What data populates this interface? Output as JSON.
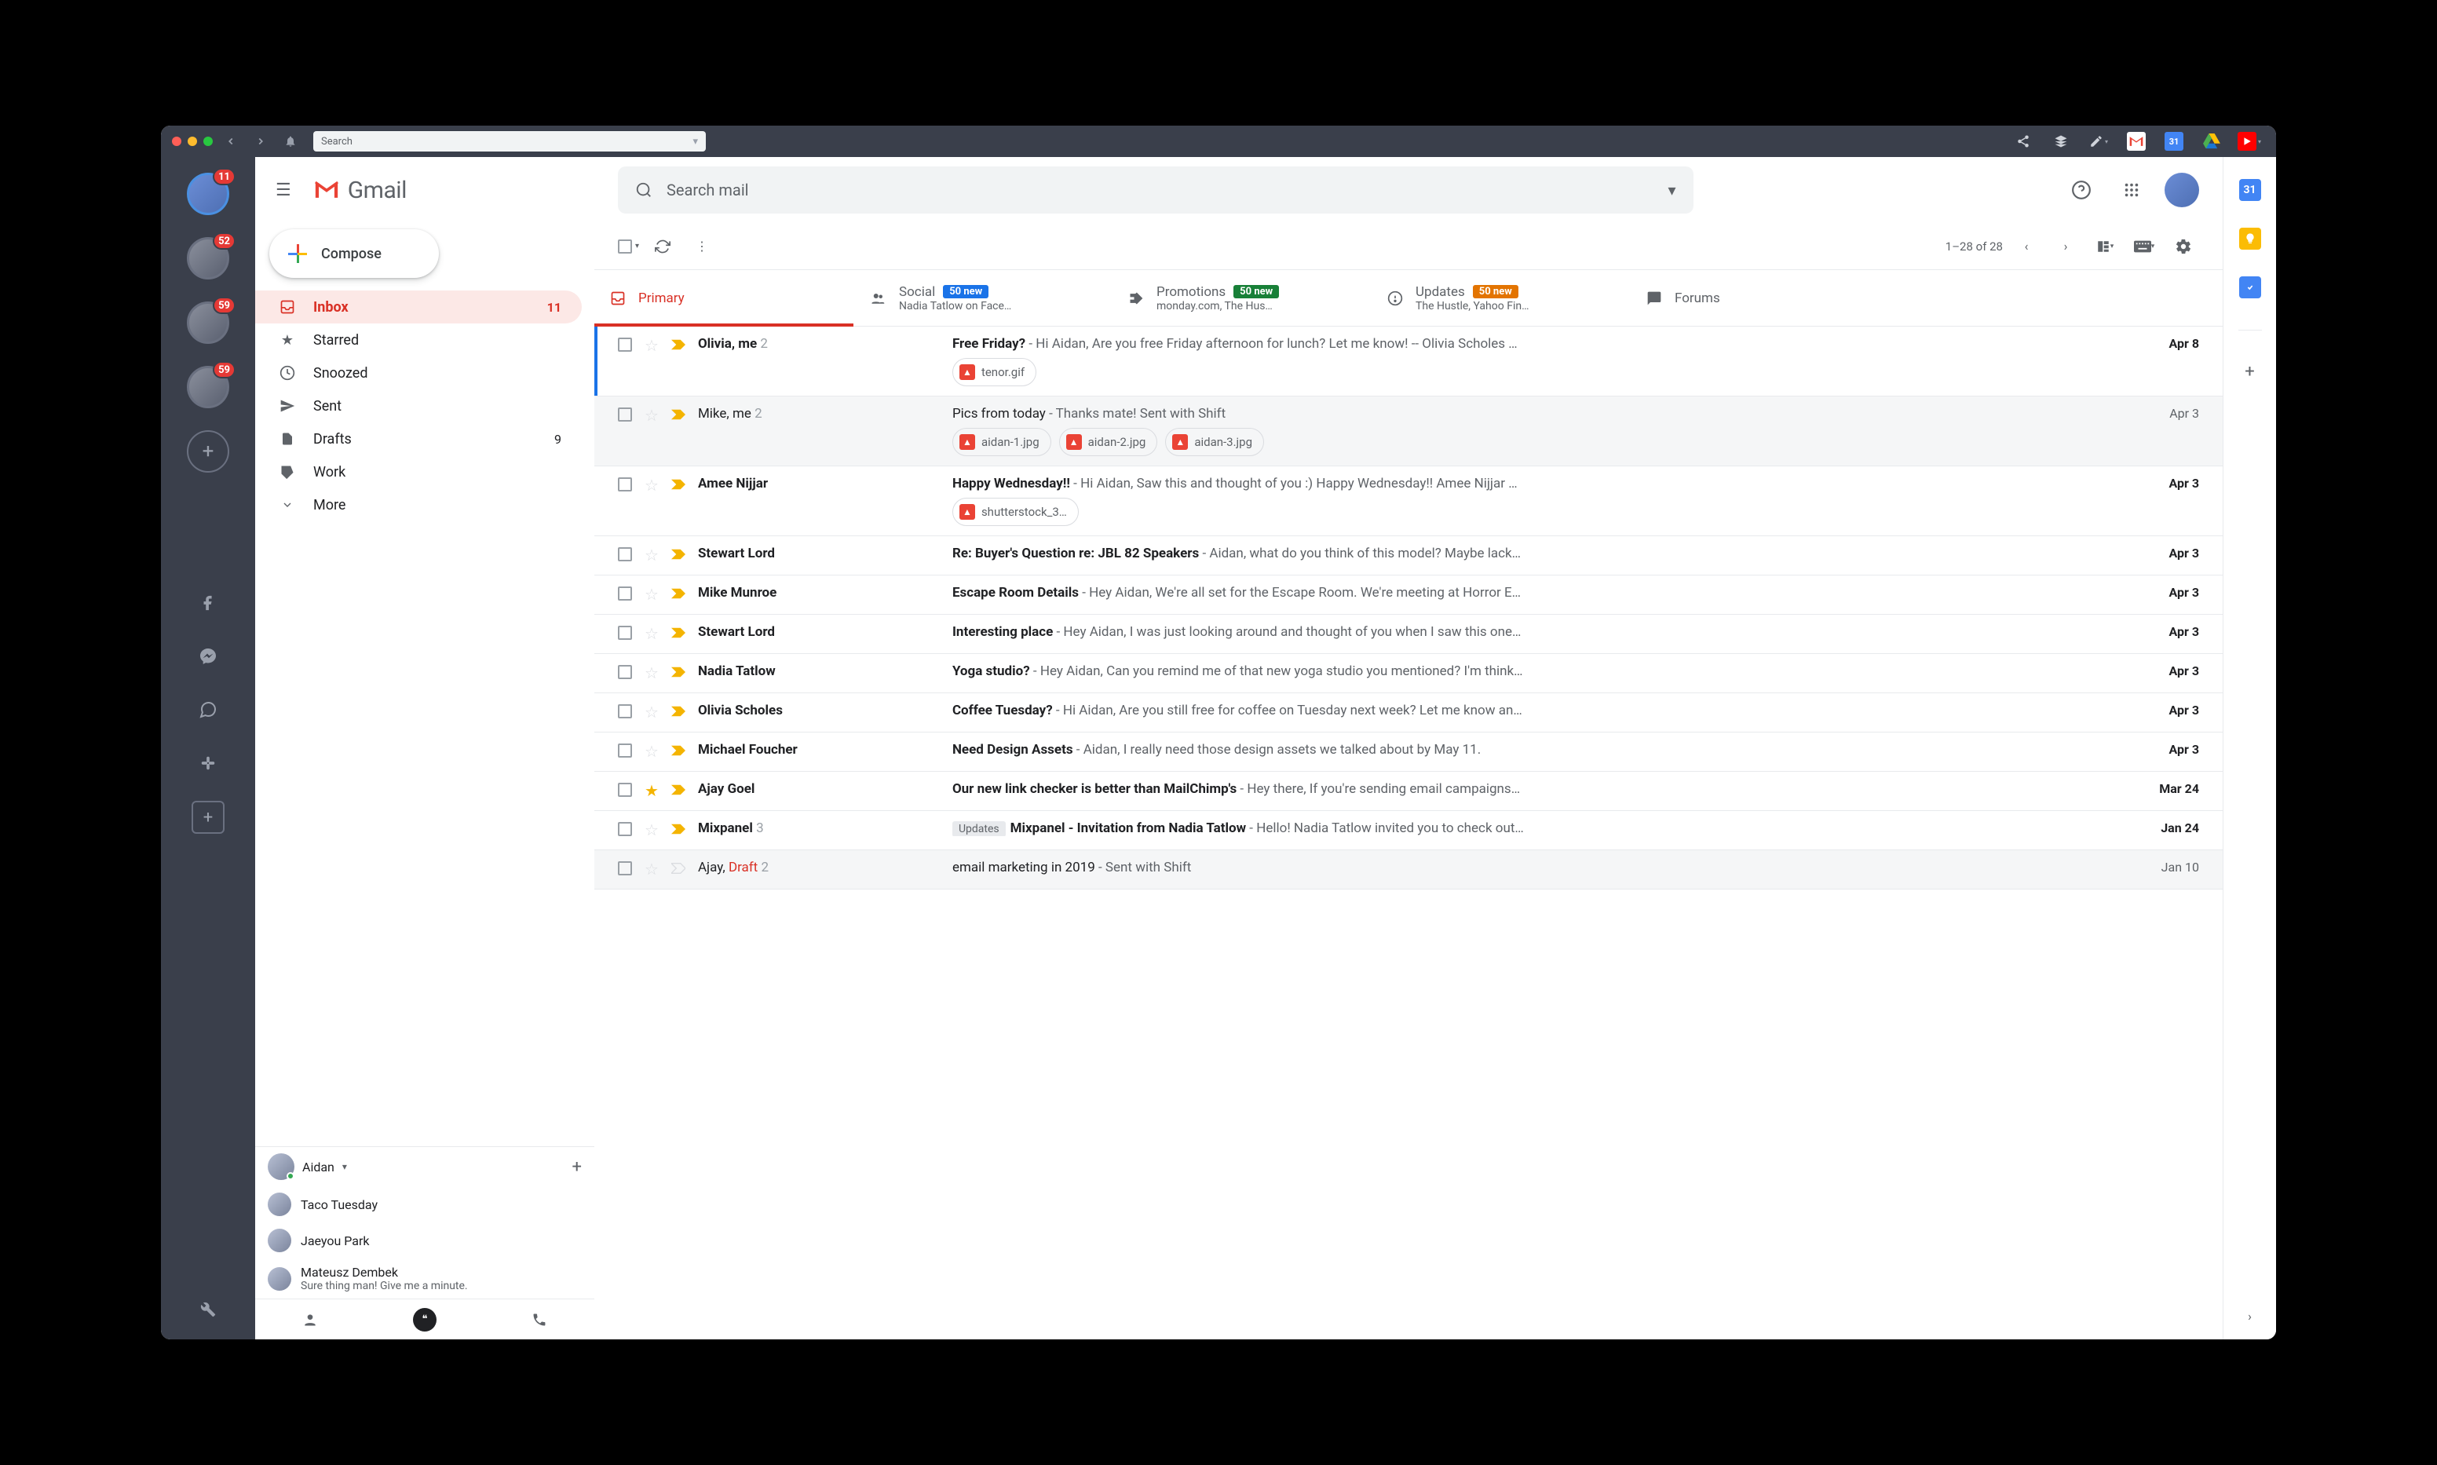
{
  "titlebar": {
    "search_placeholder": "Search"
  },
  "siderail": {
    "badges": [
      "11",
      "52",
      "59",
      "59"
    ]
  },
  "header": {
    "brand": "Gmail",
    "search_placeholder": "Search mail"
  },
  "compose_label": "Compose",
  "nav": [
    {
      "icon": "inbox",
      "label": "Inbox",
      "count": "11",
      "active": true
    },
    {
      "icon": "star",
      "label": "Starred"
    },
    {
      "icon": "clock",
      "label": "Snoozed"
    },
    {
      "icon": "send",
      "label": "Sent"
    },
    {
      "icon": "file",
      "label": "Drafts",
      "count": "9"
    },
    {
      "icon": "tag",
      "label": "Work"
    },
    {
      "icon": "more",
      "label": "More"
    }
  ],
  "hangouts": {
    "user": "Aidan",
    "contacts": [
      {
        "name": "Taco Tuesday"
      },
      {
        "name": "Jaeyou Park"
      },
      {
        "name": "Mateusz Dembek",
        "sub": "Sure thing man! Give me a minute."
      }
    ]
  },
  "toolbar": {
    "page_info": "1–28 of 28"
  },
  "tabs": [
    {
      "name": "Primary",
      "active": true
    },
    {
      "name": "Social",
      "chip": "50 new",
      "chip_color": "blue",
      "sub": "Nadia Tatlow on Face…"
    },
    {
      "name": "Promotions",
      "chip": "50 new",
      "chip_color": "green",
      "sub": "monday.com, The Hus…"
    },
    {
      "name": "Updates",
      "chip": "50 new",
      "chip_color": "orange",
      "sub": "The Hustle, Yahoo Fin…"
    },
    {
      "name": "Forums"
    }
  ],
  "rows": [
    {
      "sender": "Olivia, me",
      "num": "2",
      "subj": "Free Friday?",
      "snip": " - Hi Aidan, Are you free Friday afternoon for lunch? Let me know! -- Olivia Scholes …",
      "date": "Apr 8",
      "unread": true,
      "atts": [
        "tenor.gif"
      ],
      "sel": true
    },
    {
      "sender": "Mike, me",
      "num": "2",
      "subj": "Pics from today",
      "snip": " - Thanks mate! Sent with Shift",
      "date": "Apr 3",
      "unread": false,
      "atts": [
        "aidan-1.jpg",
        "aidan-2.jpg",
        "aidan-3.jpg"
      ]
    },
    {
      "sender": "Amee Nijjar",
      "subj": "Happy Wednesday!!",
      "snip": " - Hi Aidan, Saw this and thought of you :) Happy Wednesday!! Amee Nijjar …",
      "date": "Apr 3",
      "unread": true,
      "atts": [
        "shutterstock_3…"
      ]
    },
    {
      "sender": "Stewart Lord",
      "subj": "Re: Buyer's Question re: JBL 82 Speakers",
      "snip": " - Aidan, what do you think of this model? Maybe lack…",
      "date": "Apr 3",
      "unread": true
    },
    {
      "sender": "Mike Munroe",
      "subj": "Escape Room Details",
      "snip": " - Hey Aidan, We're all set for the Escape Room. We're meeting at Horror E…",
      "date": "Apr 3",
      "unread": true
    },
    {
      "sender": "Stewart Lord",
      "subj": "Interesting place",
      "snip": " - Hey Aidan, I was just looking around and thought of you when I saw this one…",
      "date": "Apr 3",
      "unread": true
    },
    {
      "sender": "Nadia Tatlow",
      "subj": "Yoga studio?",
      "snip": " - Hey Aidan, Can you remind me of that new yoga studio you mentioned? I'm think…",
      "date": "Apr 3",
      "unread": true
    },
    {
      "sender": "Olivia Scholes",
      "subj": "Coffee Tuesday?",
      "snip": " - Hi Aidan, Are you still free for coffee on Tuesday next week? Let me know an…",
      "date": "Apr 3",
      "unread": true
    },
    {
      "sender": "Michael Foucher",
      "subj": "Need Design Assets",
      "snip": " - Aidan, I really need those design assets we talked about by May 11.",
      "date": "Apr 3",
      "unread": true
    },
    {
      "sender": "Ajay Goel",
      "subj": "Our new link checker is better than MailChimp's",
      "snip": " - Hey there, If you're sending email campaigns…",
      "date": "Mar 24",
      "unread": true,
      "star": true
    },
    {
      "sender": "Mixpanel",
      "num": "3",
      "subj": "Mixpanel - Invitation from Nadia Tatlow",
      "snip": " - Hello! Nadia Tatlow invited you to check out…",
      "date": "Jan 24",
      "unread": true,
      "upd": true
    },
    {
      "sender": "Ajay, ",
      "draft": "Draft",
      "num": "2",
      "subj": "email marketing in 2019",
      "snip": " - Sent with Shift",
      "date": "Jan 10",
      "unread": false
    }
  ]
}
